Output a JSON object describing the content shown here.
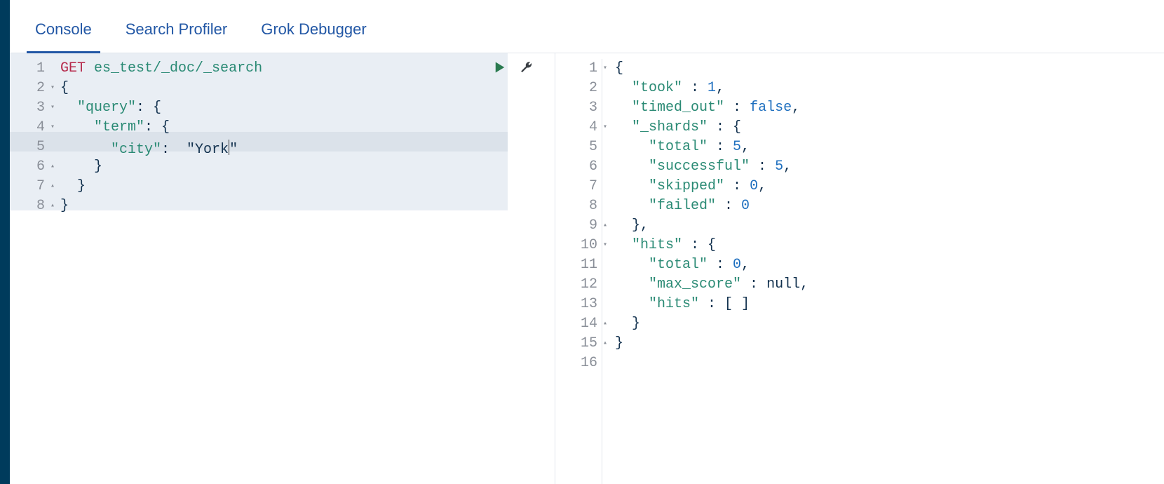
{
  "tabs": {
    "items": [
      {
        "label": "Console",
        "active": true
      },
      {
        "label": "Search Profiler",
        "active": false
      },
      {
        "label": "Grok Debugger",
        "active": false
      }
    ]
  },
  "request": {
    "icons": {
      "run": "play-icon",
      "tools": "wrench-icon"
    },
    "active_line": 5,
    "lines": [
      {
        "n": 1,
        "fold": "",
        "tokens": [
          [
            "method",
            "GET"
          ],
          [
            "space",
            " "
          ],
          [
            "path",
            "es_test/_doc/_search"
          ]
        ]
      },
      {
        "n": 2,
        "fold": "open",
        "tokens": [
          [
            "punct",
            "{"
          ]
        ]
      },
      {
        "n": 3,
        "fold": "open",
        "tokens": [
          [
            "indent",
            "  "
          ],
          [
            "key",
            "\"query\""
          ],
          [
            "punct",
            ": {"
          ]
        ]
      },
      {
        "n": 4,
        "fold": "open",
        "tokens": [
          [
            "indent",
            "    "
          ],
          [
            "key",
            "\"term\""
          ],
          [
            "punct",
            ": {"
          ]
        ]
      },
      {
        "n": 5,
        "fold": "",
        "tokens": [
          [
            "indent",
            "      "
          ],
          [
            "key",
            "\"city\""
          ],
          [
            "punct",
            ":  "
          ],
          [
            "string",
            "\"York"
          ],
          [
            "cursor",
            ""
          ],
          [
            "string",
            "\""
          ]
        ]
      },
      {
        "n": 6,
        "fold": "close",
        "tokens": [
          [
            "indent",
            "    "
          ],
          [
            "punct",
            "}"
          ]
        ]
      },
      {
        "n": 7,
        "fold": "close",
        "tokens": [
          [
            "indent",
            "  "
          ],
          [
            "punct",
            "}"
          ]
        ]
      },
      {
        "n": 8,
        "fold": "close",
        "tokens": [
          [
            "punct",
            "}"
          ]
        ]
      }
    ]
  },
  "response": {
    "lines": [
      {
        "n": 1,
        "fold": "open",
        "tokens": [
          [
            "punct",
            "{"
          ]
        ]
      },
      {
        "n": 2,
        "fold": "",
        "tokens": [
          [
            "indent",
            "  "
          ],
          [
            "key",
            "\"took\""
          ],
          [
            "punct",
            " : "
          ],
          [
            "number",
            "1"
          ],
          [
            "punct",
            ","
          ]
        ]
      },
      {
        "n": 3,
        "fold": "",
        "tokens": [
          [
            "indent",
            "  "
          ],
          [
            "key",
            "\"timed_out\""
          ],
          [
            "punct",
            " : "
          ],
          [
            "bool",
            "false"
          ],
          [
            "punct",
            ","
          ]
        ]
      },
      {
        "n": 4,
        "fold": "open",
        "tokens": [
          [
            "indent",
            "  "
          ],
          [
            "key",
            "\"_shards\""
          ],
          [
            "punct",
            " : {"
          ]
        ]
      },
      {
        "n": 5,
        "fold": "",
        "tokens": [
          [
            "indent",
            "    "
          ],
          [
            "key",
            "\"total\""
          ],
          [
            "punct",
            " : "
          ],
          [
            "number",
            "5"
          ],
          [
            "punct",
            ","
          ]
        ]
      },
      {
        "n": 6,
        "fold": "",
        "tokens": [
          [
            "indent",
            "    "
          ],
          [
            "key",
            "\"successful\""
          ],
          [
            "punct",
            " : "
          ],
          [
            "number",
            "5"
          ],
          [
            "punct",
            ","
          ]
        ]
      },
      {
        "n": 7,
        "fold": "",
        "tokens": [
          [
            "indent",
            "    "
          ],
          [
            "key",
            "\"skipped\""
          ],
          [
            "punct",
            " : "
          ],
          [
            "number",
            "0"
          ],
          [
            "punct",
            ","
          ]
        ]
      },
      {
        "n": 8,
        "fold": "",
        "tokens": [
          [
            "indent",
            "    "
          ],
          [
            "key",
            "\"failed\""
          ],
          [
            "punct",
            " : "
          ],
          [
            "number",
            "0"
          ]
        ]
      },
      {
        "n": 9,
        "fold": "close",
        "tokens": [
          [
            "indent",
            "  "
          ],
          [
            "punct",
            "},"
          ]
        ]
      },
      {
        "n": 10,
        "fold": "open",
        "tokens": [
          [
            "indent",
            "  "
          ],
          [
            "key",
            "\"hits\""
          ],
          [
            "punct",
            " : {"
          ]
        ]
      },
      {
        "n": 11,
        "fold": "",
        "tokens": [
          [
            "indent",
            "    "
          ],
          [
            "key",
            "\"total\""
          ],
          [
            "punct",
            " : "
          ],
          [
            "number",
            "0"
          ],
          [
            "punct",
            ","
          ]
        ]
      },
      {
        "n": 12,
        "fold": "",
        "tokens": [
          [
            "indent",
            "    "
          ],
          [
            "key",
            "\"max_score\""
          ],
          [
            "punct",
            " : "
          ],
          [
            "null",
            "null"
          ],
          [
            "punct",
            ","
          ]
        ]
      },
      {
        "n": 13,
        "fold": "",
        "tokens": [
          [
            "indent",
            "    "
          ],
          [
            "key",
            "\"hits\""
          ],
          [
            "punct",
            " : [ ]"
          ]
        ]
      },
      {
        "n": 14,
        "fold": "close",
        "tokens": [
          [
            "indent",
            "  "
          ],
          [
            "punct",
            "}"
          ]
        ]
      },
      {
        "n": 15,
        "fold": "close",
        "tokens": [
          [
            "punct",
            "}"
          ]
        ]
      },
      {
        "n": 16,
        "fold": "",
        "tokens": []
      }
    ]
  }
}
